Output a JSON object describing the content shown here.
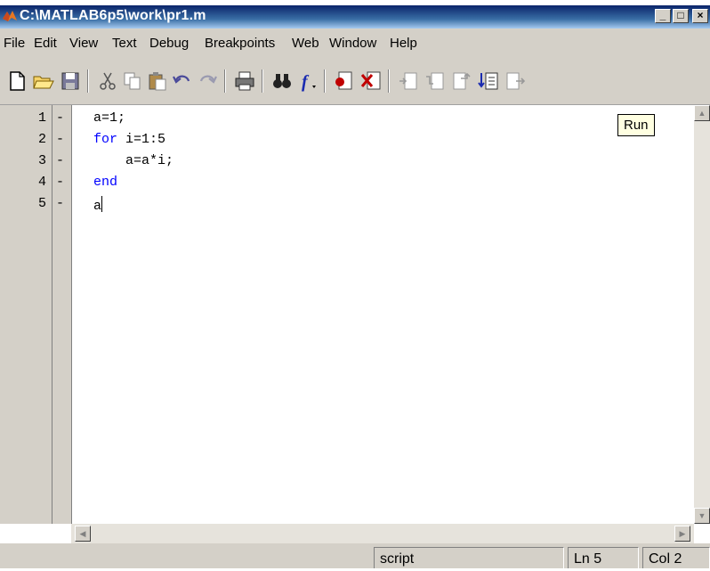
{
  "window": {
    "title": "C:\\MATLAB6p5\\work\\pr1.m"
  },
  "menu": [
    "File",
    "Edit",
    "View",
    "Text",
    "Debug",
    "Breakpoints",
    "Web",
    "Window",
    "Help"
  ],
  "tooltip": "Run",
  "editor": {
    "line_numbers": [
      "1",
      "2",
      "3",
      "4",
      "5"
    ],
    "breakpoint_marks": [
      "-",
      "-",
      "-",
      "-",
      "-"
    ],
    "lines": [
      {
        "indent": "",
        "keyword": "",
        "text": "a=1;"
      },
      {
        "indent": "",
        "keyword": "for",
        "text": " i=1:5"
      },
      {
        "indent": "    ",
        "keyword": "",
        "text": "a=a*i;"
      },
      {
        "indent": "",
        "keyword": "end",
        "text": ""
      },
      {
        "indent": "",
        "keyword": "",
        "text": "a"
      }
    ]
  },
  "status": {
    "mode": "script",
    "line": "Ln 5",
    "col": "Col 2"
  },
  "colors": {
    "titlebar": "#0a246a",
    "keyword": "#0000ff",
    "tooltip_bg": "#ffffe1",
    "chrome": "#d4d0c8"
  },
  "toolbar_icons": [
    "new-file-icon",
    "open-folder-icon",
    "save-icon",
    "cut-icon",
    "copy-icon",
    "paste-icon",
    "undo-icon",
    "redo-icon",
    "print-icon",
    "find-binoculars-icon",
    "function-icon",
    "set-breakpoint-icon",
    "clear-breakpoint-icon",
    "step-icon",
    "step-in-icon",
    "step-out-icon",
    "run-continue-icon",
    "exit-debug-icon"
  ]
}
